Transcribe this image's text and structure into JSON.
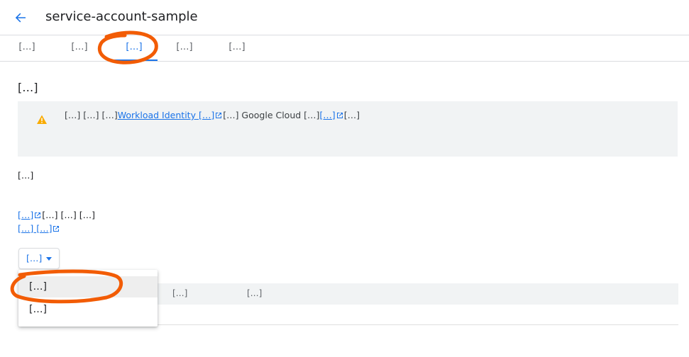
{
  "header": {
    "title": "service-account-sample"
  },
  "tabs": [
    {
      "label": "[…]"
    },
    {
      "label": "[…]"
    },
    {
      "label": "[…]"
    },
    {
      "label": "[…]"
    },
    {
      "label": "[…]"
    }
  ],
  "active_tab": "[…]",
  "section": {
    "title": "[…]"
  },
  "warning": {
    "text_1": "[…] […] […]",
    "link_1": "Workload Identity […]",
    "text_2": "[…] Google Cloud […]",
    "link_2": "[…]",
    "text_3": "[…]"
  },
  "description": "[…]",
  "policy": {
    "link_1": "[…]",
    "text_1": "[…] […] […]",
    "link_2": "[…] […]"
  },
  "add_key": {
    "label": "[…]"
  },
  "dropdown": {
    "items": [
      {
        "label": "[…]"
      },
      {
        "label": "[…]"
      }
    ]
  },
  "table": {
    "columns": [
      "[…]",
      "[…]"
    ]
  },
  "colors": {
    "accent": "#1a73e8",
    "warning_icon": "#f9ab00",
    "warning_bg": "#f1f3f4",
    "annotation": "#f25c05"
  },
  "icons": [
    "back-arrow-icon",
    "warning-icon",
    "external-link-icon",
    "dropdown-caret-icon"
  ]
}
